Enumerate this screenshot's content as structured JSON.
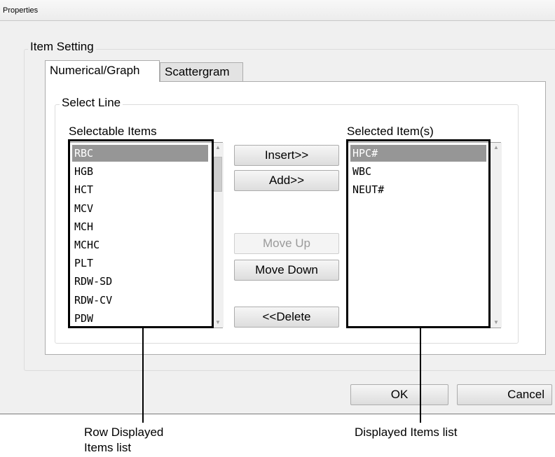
{
  "window": {
    "title": "Properties"
  },
  "item_setting": {
    "legend": "Item Setting"
  },
  "tabs": [
    {
      "label": "Numerical/Graph",
      "active": true
    },
    {
      "label": "Scattergram",
      "active": false
    }
  ],
  "select_line": {
    "legend": "Select Line"
  },
  "selectable": {
    "caption": "Selectable Items",
    "items": [
      "RBC",
      "HGB",
      "HCT",
      "MCV",
      "MCH",
      "MCHC",
      "PLT",
      "RDW-SD",
      "RDW-CV",
      "PDW"
    ],
    "selected_index": 0
  },
  "selected": {
    "caption": "Selected Item(s)",
    "items": [
      "HPC#",
      "WBC",
      "NEUT#"
    ],
    "selected_index": 0
  },
  "buttons": {
    "insert": "Insert>>",
    "add": "Add>>",
    "move_up": "Move Up",
    "move_down": "Move Down",
    "delete": "<<Delete",
    "ok": "OK",
    "cancel": "Cancel"
  },
  "annotations": {
    "left": "Row Displayed\nItems list",
    "right": "Displayed Items list"
  },
  "colors": {
    "dialog_bg": "#f0f0f0",
    "selection": "#969696",
    "callout": "#000000"
  }
}
